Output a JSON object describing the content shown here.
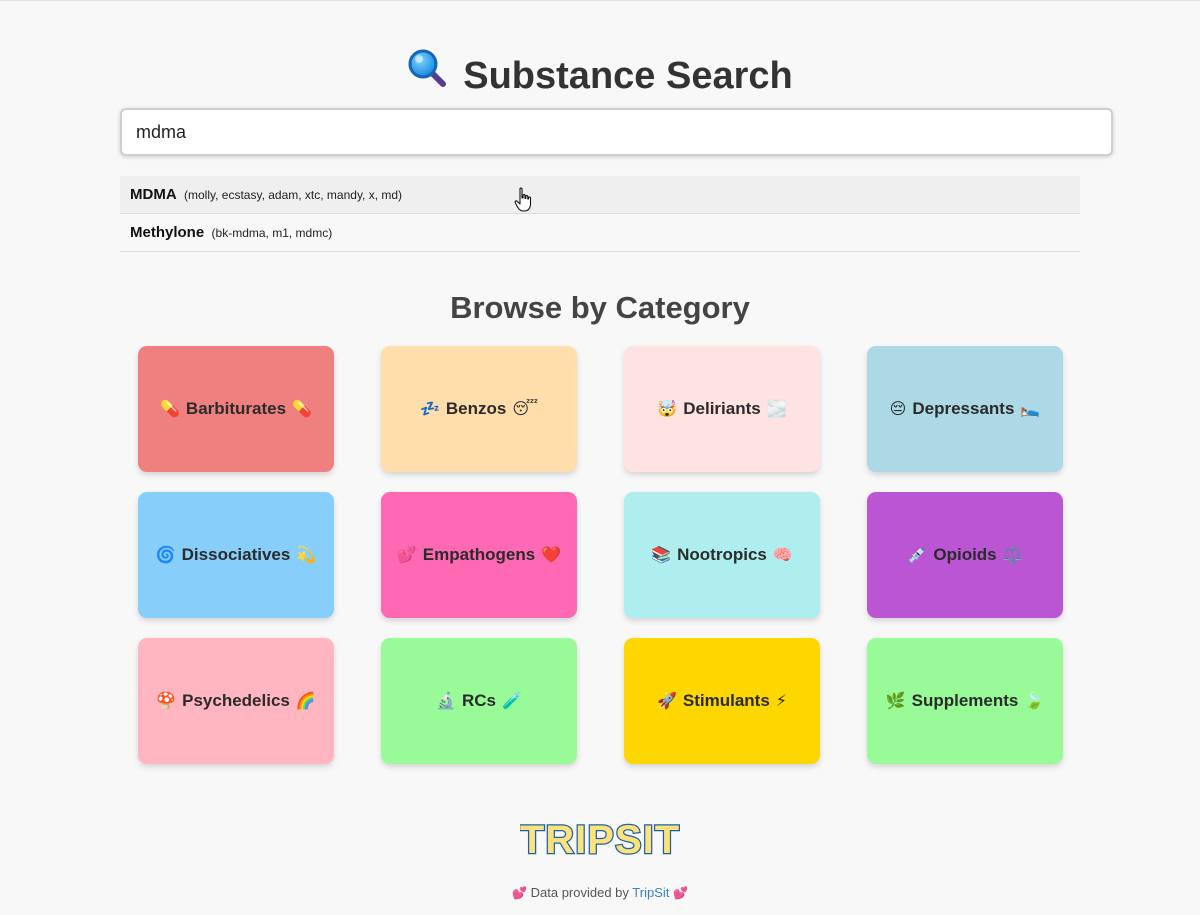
{
  "header": {
    "title": "Substance Search",
    "title_icon": "magnifying-glass-icon"
  },
  "search": {
    "value": "mdma"
  },
  "suggestions": [
    {
      "name": "MDMA",
      "aliases": "(molly, ecstasy, adam, xtc, mandy, x, md)"
    },
    {
      "name": "Methylone",
      "aliases": "(bk-mdma, m1, mdmc)"
    }
  ],
  "browse": {
    "title": "Browse by Category",
    "categories": [
      {
        "label": "Barbiturates",
        "left": "💊",
        "right": "💊",
        "color": "#f08080"
      },
      {
        "label": "Benzos",
        "left": "💤",
        "right": "😴",
        "color": "#ffdeab"
      },
      {
        "label": "Deliriants",
        "left": "🤯",
        "right": "🌫️",
        "color": "#ffe2e2"
      },
      {
        "label": "Depressants",
        "left": "😔",
        "right": "🛌",
        "color": "#add8e6"
      },
      {
        "label": "Dissociatives",
        "left": "🌀",
        "right": "💫",
        "color": "#87cefa"
      },
      {
        "label": "Empathogens",
        "left": "💕",
        "right": "❤️",
        "color": "#ff69b4"
      },
      {
        "label": "Nootropics",
        "left": "📚",
        "right": "🧠",
        "color": "#afeeee"
      },
      {
        "label": "Opioids",
        "left": "💉",
        "right": "⚖️",
        "color": "#ba55d3"
      },
      {
        "label": "Psychedelics",
        "left": "🍄",
        "right": "🌈",
        "color": "#ffb6c1"
      },
      {
        "label": "RCs",
        "left": "🔬",
        "right": "🧪",
        "color": "#98fb98"
      },
      {
        "label": "Stimulants",
        "left": "🚀",
        "right": "⚡",
        "color": "#ffd700"
      },
      {
        "label": "Supplements",
        "left": "🌿",
        "right": "🍃",
        "color": "#98fb98"
      }
    ]
  },
  "logo": {
    "text": "TRIPSIT"
  },
  "footer": {
    "heart": "💕",
    "prefix": "Data provided by",
    "link": "TripSit"
  }
}
